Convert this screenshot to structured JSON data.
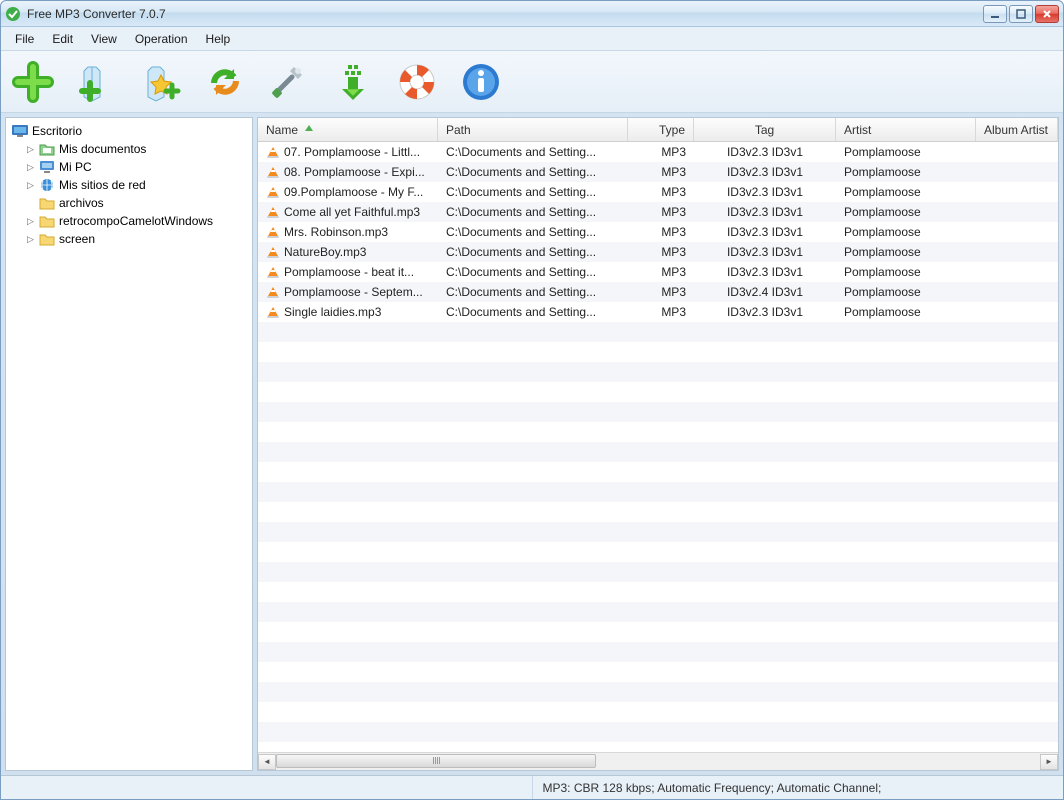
{
  "window": {
    "title": "Free MP3 Converter 7.0.7"
  },
  "menu": {
    "file": "File",
    "edit": "Edit",
    "view": "View",
    "operation": "Operation",
    "help": "Help"
  },
  "sidebar": {
    "root": "Escritorio",
    "items": [
      {
        "label": "Mis documentos",
        "expandable": true
      },
      {
        "label": "Mi PC",
        "expandable": true
      },
      {
        "label": "Mis sitios de red",
        "expandable": true
      },
      {
        "label": "archivos",
        "expandable": false
      },
      {
        "label": "retrocompoCamelotWindows",
        "expandable": true
      },
      {
        "label": "screen",
        "expandable": true
      }
    ]
  },
  "table": {
    "headers": {
      "name": "Name",
      "path": "Path",
      "type": "Type",
      "tag": "Tag",
      "artist": "Artist",
      "album_artist": "Album Artist"
    },
    "rows": [
      {
        "name": "07. Pomplamoose - Littl...",
        "path": "C:\\Documents and Setting...",
        "type": "MP3",
        "tag": "ID3v2.3  ID3v1",
        "artist": "Pomplamoose",
        "album_artist": ""
      },
      {
        "name": "08. Pomplamoose - Expi...",
        "path": "C:\\Documents and Setting...",
        "type": "MP3",
        "tag": "ID3v2.3  ID3v1",
        "artist": "Pomplamoose",
        "album_artist": ""
      },
      {
        "name": "09.Pomplamoose - My F...",
        "path": "C:\\Documents and Setting...",
        "type": "MP3",
        "tag": "ID3v2.3  ID3v1",
        "artist": "Pomplamoose",
        "album_artist": ""
      },
      {
        "name": "Come all yet Faithful.mp3",
        "path": "C:\\Documents and Setting...",
        "type": "MP3",
        "tag": "ID3v2.3  ID3v1",
        "artist": "Pomplamoose",
        "album_artist": ""
      },
      {
        "name": "Mrs. Robinson.mp3",
        "path": "C:\\Documents and Setting...",
        "type": "MP3",
        "tag": "ID3v2.3  ID3v1",
        "artist": "Pomplamoose",
        "album_artist": ""
      },
      {
        "name": "NatureBoy.mp3",
        "path": "C:\\Documents and Setting...",
        "type": "MP3",
        "tag": "ID3v2.3  ID3v1",
        "artist": "Pomplamoose",
        "album_artist": ""
      },
      {
        "name": "Pomplamoose - beat it...",
        "path": "C:\\Documents and Setting...",
        "type": "MP3",
        "tag": "ID3v2.3  ID3v1",
        "artist": "Pomplamoose",
        "album_artist": ""
      },
      {
        "name": "Pomplamoose - Septem...",
        "path": "C:\\Documents and Setting...",
        "type": "MP3",
        "tag": "ID3v2.4  ID3v1",
        "artist": "Pomplamoose",
        "album_artist": ""
      },
      {
        "name": "Single laidies.mp3",
        "path": "C:\\Documents and Setting...",
        "type": "MP3",
        "tag": "ID3v2.3  ID3v1",
        "artist": "Pomplamoose",
        "album_artist": ""
      }
    ]
  },
  "statusbar": {
    "left": "",
    "right": "MP3:  CBR 128 kbps; Automatic Frequency; Automatic Channel;"
  }
}
